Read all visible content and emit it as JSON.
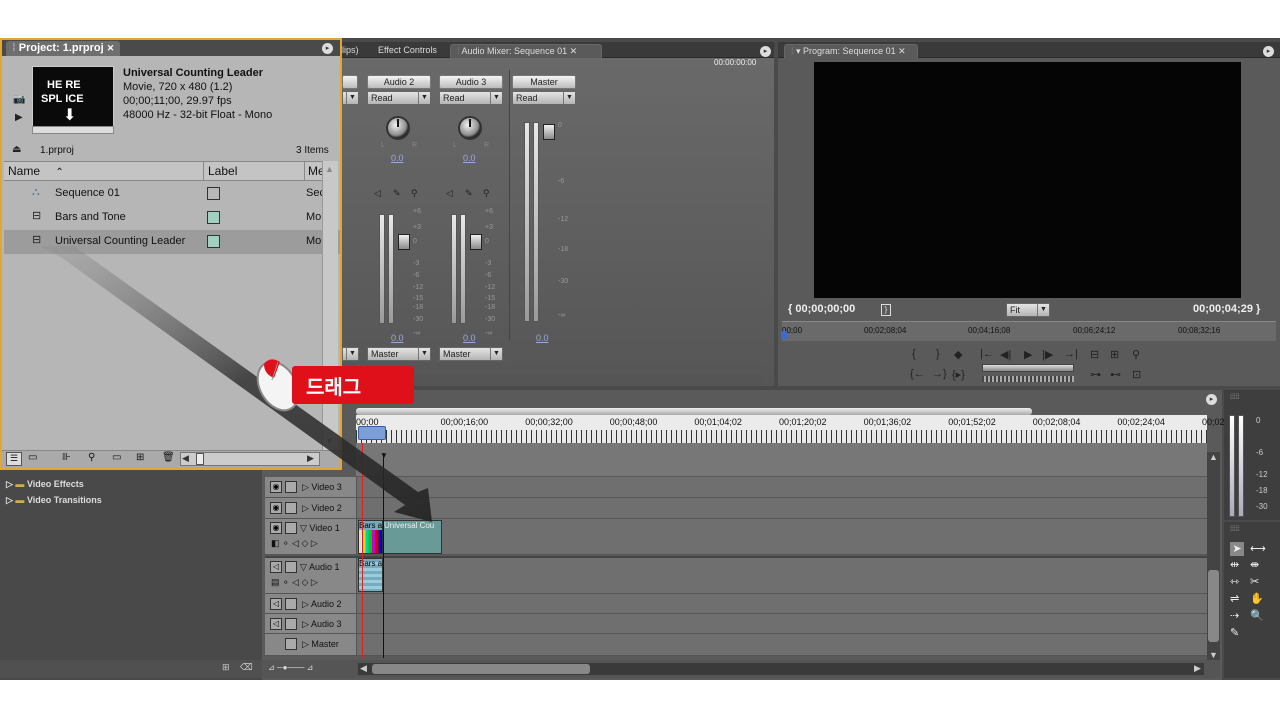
{
  "project": {
    "tab": "Project: 1.prproj",
    "clip_title": "Universal Counting Leader",
    "clip_line1": "Movie, 720 x 480 (1.2)",
    "clip_line2": "00;00;11;00, 29.97 fps",
    "clip_line3": "48000 Hz - 32-bit Float - Mono",
    "thumb_top": "HE RE",
    "thumb_bottom": "SPL ICE",
    "bin_name": "1.prproj",
    "item_count": "3 Items",
    "columns": [
      "Name",
      "Label",
      "Me"
    ],
    "items": [
      {
        "name": "Sequence 01",
        "label_color": "#b8b8b8",
        "media": "Sec"
      },
      {
        "name": "Bars and Tone",
        "label_color": "#9fd0c0",
        "media": "Mo"
      },
      {
        "name": "Universal Counting Leader",
        "label_color": "#9fd0c0",
        "media": "Mo"
      }
    ]
  },
  "effects": {
    "video_effects": "Video Effects",
    "video_transitions": "Video Transitions"
  },
  "source_tabs": [
    "lips)",
    "Effect Controls",
    "Audio Mixer: Sequence 01"
  ],
  "mixer": {
    "timecode": "00:00:00:00",
    "channels": [
      {
        "name": "Audio 2",
        "mode": "Read",
        "pan": "0.0",
        "level": "0.0",
        "output": "Master"
      },
      {
        "name": "Audio 3",
        "mode": "Read",
        "pan": "0.0",
        "level": "0.0",
        "output": "Master"
      },
      {
        "name": "Master",
        "mode": "Read",
        "level": "0.0"
      }
    ],
    "left_mode": "",
    "scale": [
      "+6",
      "+3",
      "0",
      "-3",
      "-6",
      "-12",
      "-15",
      "-18",
      "-30",
      "-∞"
    ],
    "master_scale": [
      "0",
      "-6",
      "-12",
      "-18",
      "-30",
      "-∞"
    ]
  },
  "program": {
    "tab": "Program: Sequence 01",
    "timecode_in": "00;00;00;00",
    "timecode_out": "00;00;04;29",
    "zoom": "Fit",
    "ruler": [
      "00;00",
      "00;02;08;04",
      "00;04;16;08",
      "00;06;24;12",
      "00;08;32;16"
    ]
  },
  "annotation": {
    "label": "드래그"
  },
  "timeline": {
    "ruler": [
      "00;00",
      "00;00;16;00",
      "00;00;32;00",
      "00;00;48;00",
      "00;01;04;02",
      "00;01;20;02",
      "00;01;36;02",
      "00;01;52;02",
      "00;02;08;04",
      "00;02;24;04",
      "00;02;4"
    ],
    "tracks": {
      "video3": "Video 3",
      "video2": "Video 2",
      "video1": "Video 1",
      "audio1": "Audio 1",
      "audio2": "Audio 2",
      "audio3": "Audio 3",
      "master": "Master"
    },
    "clip_bars": "Bars a",
    "clip_ucl": "Universal Cou",
    "clip_bars_audio": "Bars a"
  },
  "meter_scale": [
    "0",
    "-6",
    "-12",
    "-18",
    "-30"
  ],
  "colors": {
    "highlight": "#e4a62e",
    "annotation": "#e0101a"
  }
}
